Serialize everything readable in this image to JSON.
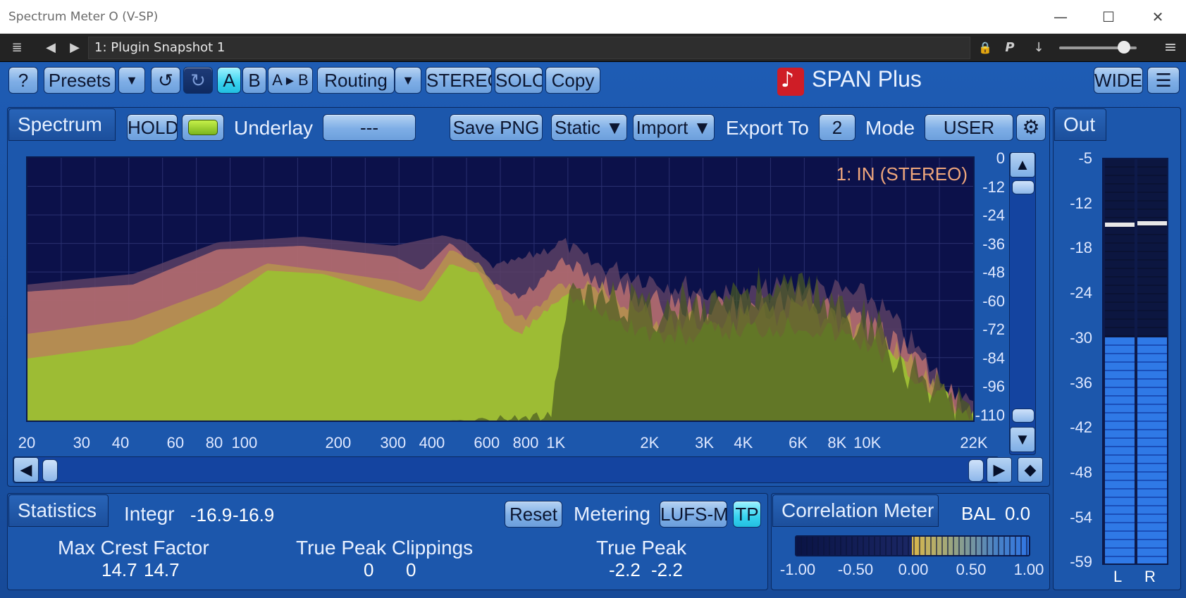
{
  "window": {
    "title": "Spectrum Meter O (V-SP)",
    "min": "—",
    "max": "☐",
    "close": "✕"
  },
  "host": {
    "preset": "1: Plugin Snapshot 1",
    "icons": {
      "settings": "≣",
      "prev": "◀",
      "next": "▶",
      "lock": "🔒",
      "p": "P",
      "arrow": "↓",
      "menu": "≡"
    }
  },
  "toolbar": {
    "help": "?",
    "presets": "Presets",
    "dropdown": "▼",
    "undo": "↺",
    "ab_a": "A",
    "ab_b": "B",
    "ab_copy": "A ▸ B",
    "routing": "Routing",
    "stereo": "STEREO",
    "solo": "SOLO",
    "copy": "Copy",
    "brand": "SPAN Plus",
    "wide": "WIDE",
    "menu": "☰"
  },
  "spectrum": {
    "tab": "Spectrum",
    "hold": "HOLD",
    "underlay_label": "Underlay",
    "underlay_value": "---",
    "save_png": "Save PNG",
    "static": "Static ▼",
    "import": "Import ▼",
    "export_label": "Export To",
    "export_value": "2",
    "mode_label": "Mode",
    "mode_value": "USER",
    "gear": "⚙",
    "channel_label": "1: IN (STEREO)",
    "db_scale": [
      "0",
      "-12",
      "-24",
      "-36",
      "-48",
      "-60",
      "-72",
      "-84",
      "-96",
      "-110"
    ],
    "freq_labels": [
      "20",
      "30",
      "40",
      "60",
      "80",
      "100",
      "200",
      "300",
      "400",
      "600",
      "800",
      "1K",
      "2K",
      "3K",
      "4K",
      "6K",
      "8K",
      "10K",
      "22K"
    ],
    "up": "▲",
    "down": "▼",
    "left": "◀",
    "right": "▶",
    "diamond": "◆"
  },
  "statistics": {
    "tab": "Statistics",
    "integr_label": "Integr",
    "integr_l": "-16.9",
    "integr_r": "-16.9",
    "reset": "Reset",
    "metering_label": "Metering",
    "metering_value": "LUFS-ML",
    "tp": "TP",
    "max_crest_label": "Max Crest Factor",
    "max_crest_l": "14.7",
    "max_crest_r": "14.7",
    "tp_clip_label": "True Peak Clippings",
    "tp_clip_l": "0",
    "tp_clip_r": "0",
    "true_peak_label": "True Peak",
    "true_peak_l": "-2.2",
    "true_peak_r": "-2.2"
  },
  "correlation": {
    "tab": "Correlation Meter",
    "bal_label": "BAL",
    "bal_value": "0.0",
    "scale": [
      "-1.00",
      "-0.50",
      "0.00",
      "0.50",
      "1.00"
    ]
  },
  "out": {
    "tab": "Out",
    "scale": [
      "-5",
      "-12",
      "-18",
      "-24",
      "-30",
      "-36",
      "-42",
      "-48",
      "-54",
      "-59"
    ],
    "ch_l": "L",
    "ch_r": "R",
    "level_fraction": 0.56
  },
  "colors": {
    "accent": "#1e5cb4",
    "spectrum_fill": "#9dbc34",
    "hold_fill": "#c07a74",
    "header_red": "#cf1d26",
    "label_orange": "#f0a77c"
  }
}
